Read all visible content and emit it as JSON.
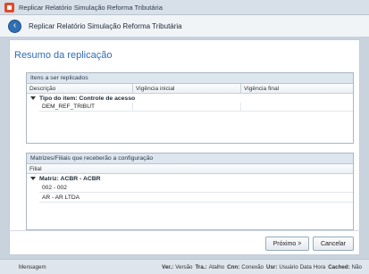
{
  "window": {
    "title": "Replicar Relatório Simulação Reforma Tributária"
  },
  "header": {
    "title": "Replicar Relatório Simulação Reforma Tributária"
  },
  "section": {
    "title": "Resumo da replicação"
  },
  "items_grid": {
    "caption": "Itens a ser replicados",
    "columns": [
      "Descrição",
      "Vigência inicial",
      "Vigência final"
    ],
    "group_label": "Tipo do item: Controle de acesso",
    "rows": [
      {
        "descricao": "DEM_REF_TRIBUT",
        "vigencia_inicial": "",
        "vigencia_final": ""
      }
    ]
  },
  "filiais_grid": {
    "caption": "Matrizes/Filiais que receberão a configuração",
    "column": "Filial",
    "group_label": "Matriz: ACBR - ACBR",
    "rows": [
      "002 - 002",
      "AR - AR LTDA"
    ]
  },
  "buttons": {
    "next": "Próximo >",
    "cancel": "Cancelar"
  },
  "statusbar": {
    "message": "Mensagem",
    "items": [
      {
        "key": "Ver.:",
        "value": "Versão"
      },
      {
        "key": "Tra.:",
        "value": "Atalho"
      },
      {
        "key": "Cnn:",
        "value": "Conexão"
      },
      {
        "key": "Usr:",
        "value": "Usuário"
      },
      {
        "key": "",
        "value": "Data"
      },
      {
        "key": "",
        "value": "Hora"
      },
      {
        "key": "Cached:",
        "value": "Não"
      }
    ]
  }
}
